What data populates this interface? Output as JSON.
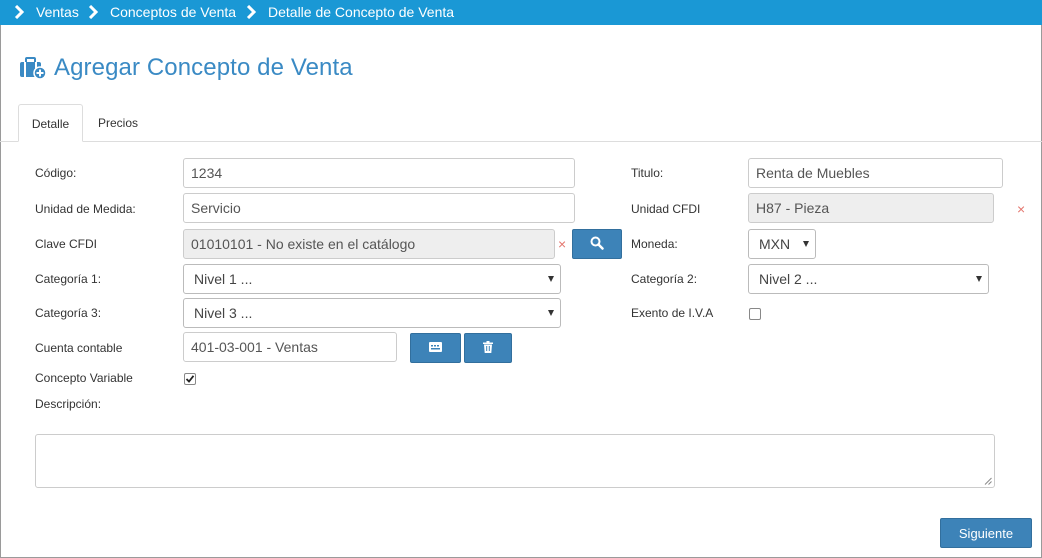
{
  "breadcrumb": [
    "Ventas",
    "Conceptos de Venta",
    "Detalle de Concepto de Venta"
  ],
  "page_title": "Agregar Concepto de Venta",
  "tabs": [
    {
      "label": "Detalle",
      "active": true
    },
    {
      "label": "Precios",
      "active": false
    }
  ],
  "form": {
    "codigo": {
      "label": "Código:",
      "value": "1234"
    },
    "unidad_medida": {
      "label": "Unidad de Medida:",
      "value": "Servicio"
    },
    "clave_cfdi": {
      "label": "Clave CFDI",
      "value": "01010101 - No existe en el catálogo"
    },
    "categoria1": {
      "label": "Categoría 1:",
      "value": "Nivel 1 ..."
    },
    "categoria3": {
      "label": "Categoría 3:",
      "value": "Nivel 3 ..."
    },
    "cuenta_contable": {
      "label": "Cuenta contable",
      "value": "401-03-001 - Ventas"
    },
    "concepto_variable": {
      "label": "Concepto Variable",
      "checked": true
    },
    "descripcion": {
      "label": "Descripción:",
      "value": ""
    },
    "titulo": {
      "label": "Titulo:",
      "value": "Renta de Muebles"
    },
    "unidad_cfdi": {
      "label": "Unidad CFDI",
      "value": "H87 - Pieza"
    },
    "moneda": {
      "label": "Moneda:",
      "value": "MXN"
    },
    "categoria2": {
      "label": "Categoría 2:",
      "value": "Nivel 2 ..."
    },
    "exento_iva": {
      "label": "Exento de I.V.A",
      "checked": false
    }
  },
  "clear_glyph": "×",
  "next_button": "Siguiente",
  "colors": {
    "header_bar": "#1a98d5",
    "title": "#3a8ac4",
    "button": "#3d83b8",
    "clear_icon": "#e4766e"
  },
  "icons": [
    "chevron-right-icon",
    "briefcase-plus-icon",
    "search-icon",
    "list-icon",
    "trash-icon",
    "check-icon"
  ]
}
